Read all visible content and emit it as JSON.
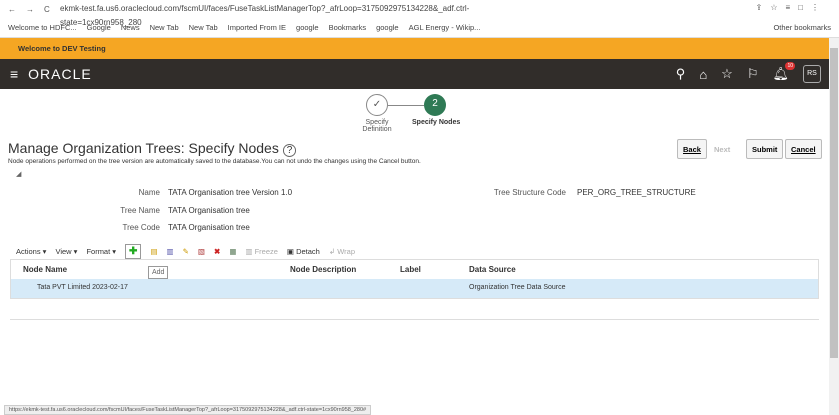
{
  "browser": {
    "url": "ekmk-test.fa.us6.oraclecloud.com/fscmUI/faces/FuseTaskListManagerTop?_afrLoop=3175092975134228&_adf.ctrl-state=1cx90rn958_280",
    "bookmarks": [
      "Welcome to HDFC...",
      "Google",
      "News",
      "New Tab",
      "New Tab",
      "Imported From IE",
      "google",
      "Bookmarks",
      "google",
      "AGL Energy - Wikip..."
    ],
    "other_bookmarks": "Other bookmarks",
    "status_url": "https://ekmk-test.fa.us6.oraclecloud.com/fscmUI/faces/FuseTaskListManagerTop?_afrLoop=3175092975134228&_adf.ctrl-state=1cx90rn958_280#"
  },
  "banner": "Welcome to DEV Testing",
  "header": {
    "logo": "ORACLE",
    "avatar": "RS",
    "notifications": "10"
  },
  "train": {
    "step1": "Specify Definition",
    "step2_num": "2",
    "step2": "Specify Nodes"
  },
  "page": {
    "title": "Manage Organization Trees: Specify Nodes",
    "help": "?",
    "note": "Node operations performed on the tree version are automatically saved to the database.You can not undo the changes using the Cancel button.",
    "buttons": {
      "back": "Back",
      "next": "Next",
      "submit": "Submit",
      "cancel": "Cancel"
    }
  },
  "fields": {
    "name_label": "Name",
    "name": "TATA Organisation tree Version 1.0",
    "tree_name_label": "Tree Name",
    "tree_name": "TATA Organisation tree",
    "tree_code_label": "Tree Code",
    "tree_code": "TATA Organisation tree",
    "structure_label": "Tree Structure Code",
    "structure": "PER_ORG_TREE_STRUCTURE"
  },
  "toolbar": {
    "actions": "Actions ▾",
    "view": "View ▾",
    "format": "Format ▾",
    "freeze": "Freeze",
    "detach": "Detach",
    "wrap": "Wrap",
    "tooltip": "Add"
  },
  "table": {
    "headers": [
      "Node Name",
      "Node Description",
      "Label",
      "Data Source"
    ],
    "rows": [
      [
        "Tata PVT Limited 2023-02-17",
        "",
        "",
        "Organization Tree Data Source"
      ]
    ]
  }
}
